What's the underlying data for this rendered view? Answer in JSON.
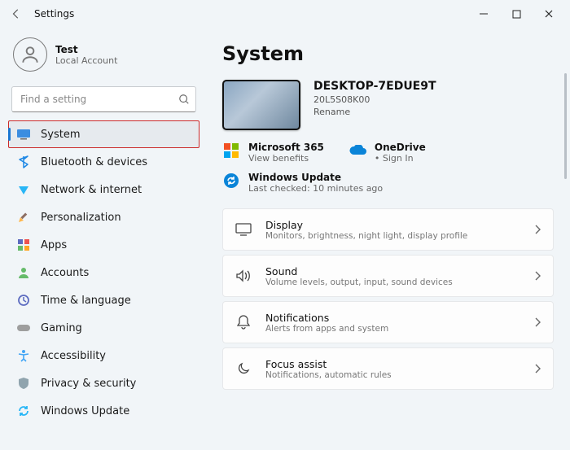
{
  "window": {
    "title": "Settings"
  },
  "user": {
    "name": "Test",
    "sub": "Local Account"
  },
  "search": {
    "placeholder": "Find a setting"
  },
  "sidebar": {
    "items": [
      {
        "label": "System",
        "key": "system",
        "selected": true
      },
      {
        "label": "Bluetooth & devices",
        "key": "bluetooth"
      },
      {
        "label": "Network & internet",
        "key": "network"
      },
      {
        "label": "Personalization",
        "key": "personalization"
      },
      {
        "label": "Apps",
        "key": "apps"
      },
      {
        "label": "Accounts",
        "key": "accounts"
      },
      {
        "label": "Time & language",
        "key": "time"
      },
      {
        "label": "Gaming",
        "key": "gaming"
      },
      {
        "label": "Accessibility",
        "key": "accessibility"
      },
      {
        "label": "Privacy & security",
        "key": "privacy"
      },
      {
        "label": "Windows Update",
        "key": "update"
      }
    ]
  },
  "main": {
    "heading": "System",
    "device": {
      "name": "DESKTOP-7EDUE9T",
      "model": "20L5S08K00",
      "rename": "Rename"
    },
    "services": {
      "m365": {
        "title": "Microsoft 365",
        "sub": "View benefits"
      },
      "onedrive": {
        "title": "OneDrive",
        "sub": "• Sign In"
      }
    },
    "wu": {
      "title": "Windows Update",
      "sub": "Last checked: 10 minutes ago"
    },
    "cards": [
      {
        "title": "Display",
        "sub": "Monitors, brightness, night light, display profile",
        "key": "display"
      },
      {
        "title": "Sound",
        "sub": "Volume levels, output, input, sound devices",
        "key": "sound"
      },
      {
        "title": "Notifications",
        "sub": "Alerts from apps and system",
        "key": "notifications"
      },
      {
        "title": "Focus assist",
        "sub": "Notifications, automatic rules",
        "key": "focus"
      }
    ]
  }
}
